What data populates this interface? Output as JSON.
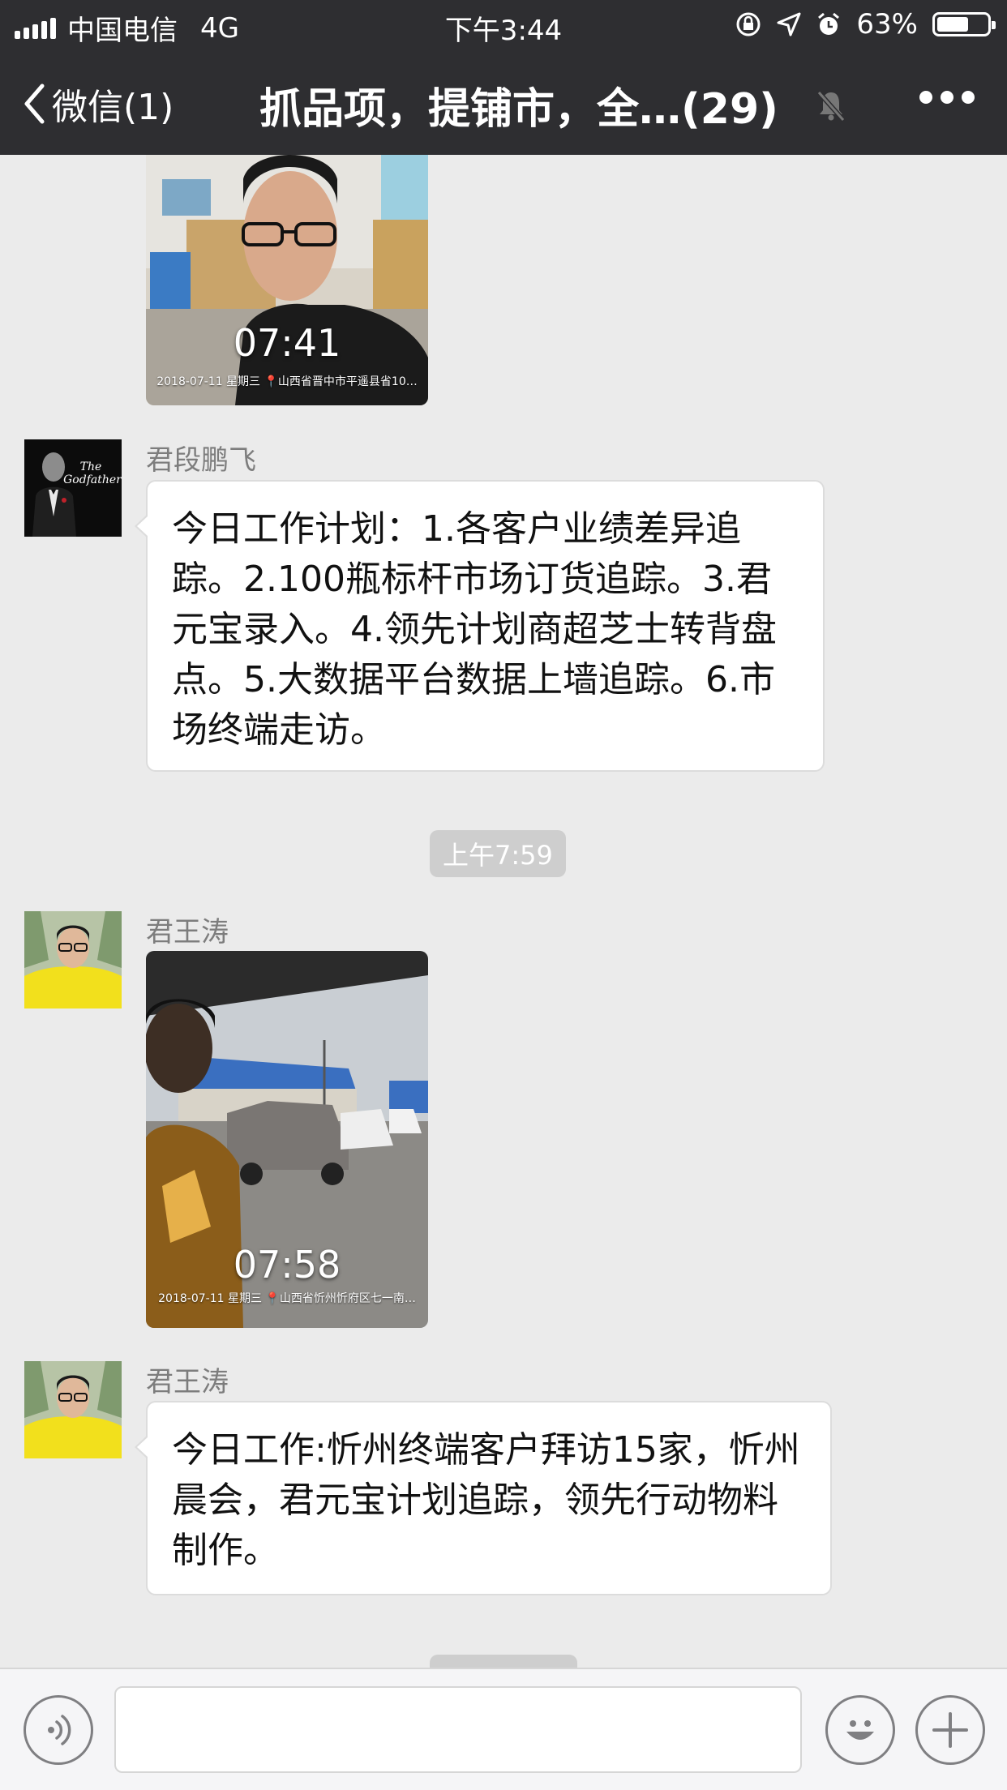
{
  "status_bar": {
    "carrier": "中国电信",
    "network": "4G",
    "time": "下午3:44",
    "battery": "63%",
    "battery_level": 0.63
  },
  "nav": {
    "back_label": "微信(1)",
    "title": "抓品项，提铺市，全…(29)"
  },
  "messages": {
    "photo1": {
      "stamp_time": "07:41",
      "stamp_info": "2018-07-11 星期三 📍山西省晋中市平遥县省10…"
    },
    "msg2": {
      "sender": "君段鹏飞",
      "text": "今日工作计划：1.各客户业绩差异追踪。2.100瓶标杆市场订货追踪。3.君元宝录入。4.领先计划商超芝士转背盘点。5.大数据平台数据上墙追踪。6.市场终端走访。"
    },
    "timestamp": "上午7:59",
    "msg3": {
      "sender": "君王涛",
      "stamp_time": "07:58",
      "stamp_info": "2018-07-11 星期三 📍山西省忻州忻府区七一南…"
    },
    "msg4": {
      "sender": "君王涛",
      "text": "今日工作:忻州终端客户拜访15家，忻州晨会，君元宝计划追踪，领先行动物料制作。"
    }
  },
  "input": {
    "value": ""
  },
  "colors": {
    "navbar": "#2e2e31",
    "chat_bg": "#ebebeb",
    "bubble": "#ffffff",
    "avatar_yellow": "#f2e01c"
  }
}
